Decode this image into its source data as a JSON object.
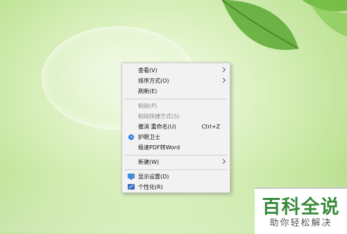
{
  "context_menu": {
    "items": [
      {
        "label": "查看(V)"
      },
      {
        "label": "排序方式(O)"
      },
      {
        "label": "刷新(E)"
      },
      {
        "label": "粘贴(P)"
      },
      {
        "label": "粘贴快捷方式(S)"
      },
      {
        "label": "撤消 重命名(U)",
        "shortcut": "Ctrl+Z"
      },
      {
        "label": "护眼卫士",
        "icon": "eye-protection-icon"
      },
      {
        "label": "极速PDF转Word"
      },
      {
        "label": "新建(W)"
      },
      {
        "label": "显示设置(D)",
        "icon": "display-settings-icon"
      },
      {
        "label": "个性化(R)",
        "icon": "personalize-icon"
      }
    ]
  },
  "watermark": {
    "title": "百科全说",
    "subtitle": "助你轻松解决"
  },
  "colors": {
    "menu_background": "#f2f2f2",
    "disabled_text": "#8a8a8a",
    "watermark_green": "#3a8b3d"
  }
}
